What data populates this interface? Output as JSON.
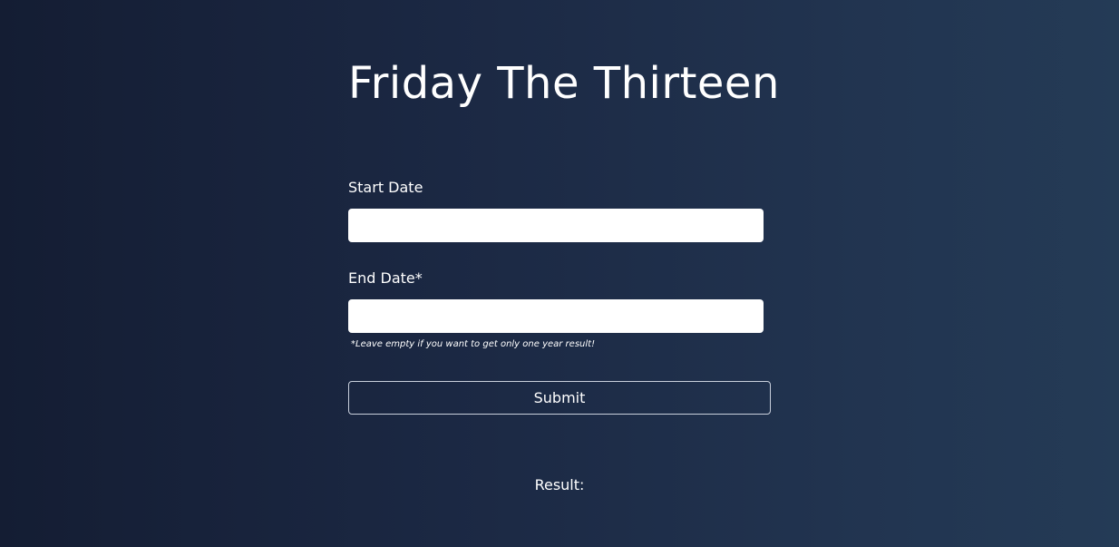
{
  "page": {
    "title": "Friday The Thirteen"
  },
  "form": {
    "start_date": {
      "label": "Start Date",
      "value": "",
      "placeholder": ""
    },
    "end_date": {
      "label": "End Date*",
      "value": "",
      "placeholder": "",
      "hint": "*Leave empty if you want to get only one year result!"
    },
    "submit_label": "Submit"
  },
  "result": {
    "label": "Result:"
  },
  "colors": {
    "background_left": "#141d33",
    "background_right": "#243b56",
    "text": "#ffffff",
    "input_background": "#ffffff",
    "button_border": "#c9d0dc"
  }
}
